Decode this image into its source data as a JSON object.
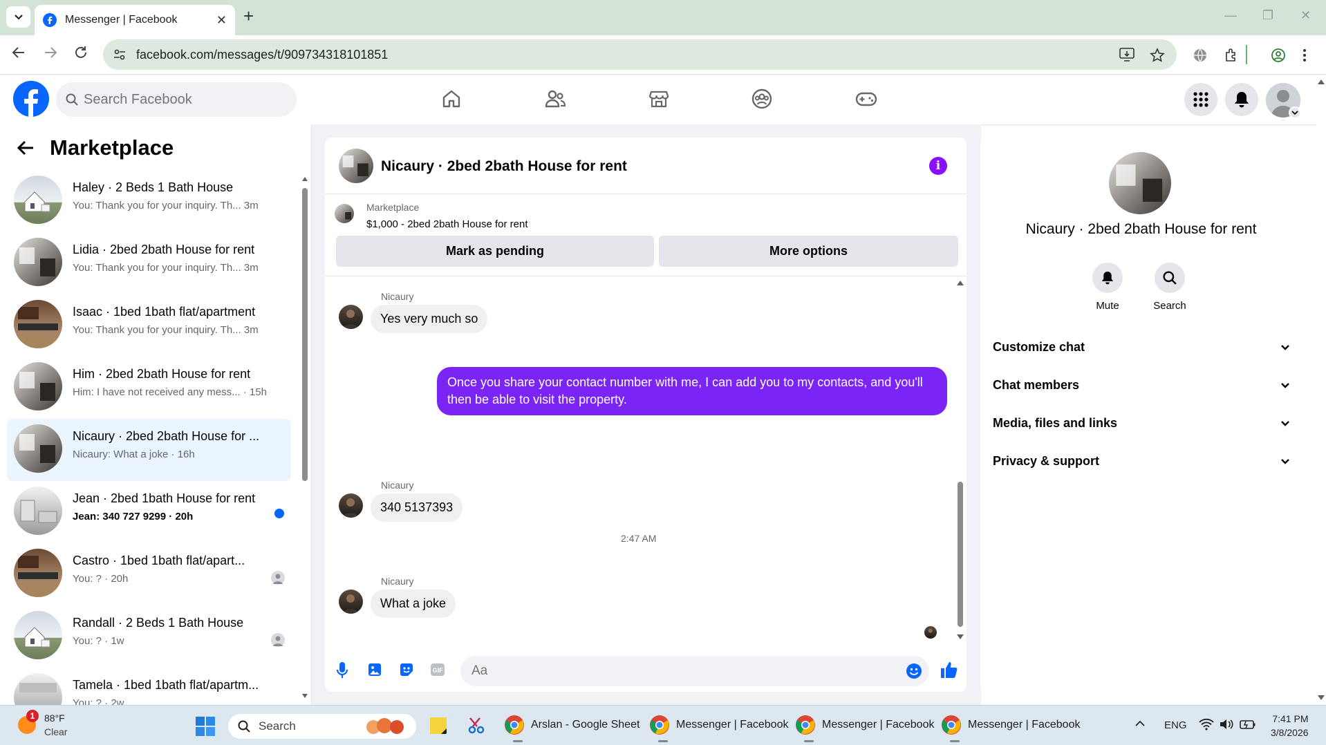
{
  "browser": {
    "tab_title": "Messenger | Facebook",
    "url": "facebook.com/messages/t/909734318101851"
  },
  "facebook": {
    "search_placeholder": "Search Facebook"
  },
  "left_panel": {
    "title": "Marketplace",
    "conversations": [
      {
        "name": "Haley · 2 Beds 1 Bath House",
        "preview": "You: Thank you for your inquiry. Th... 3m",
        "active": false
      },
      {
        "name": "Lidia · 2bed 2bath House for rent",
        "preview": "You: Thank you for your inquiry. Th... 3m",
        "active": false
      },
      {
        "name": "Isaac · 1bed 1bath flat/apartment",
        "preview": "You: Thank you for your inquiry. Th... 3m",
        "active": false
      },
      {
        "name": "Him · 2bed 2bath House for rent",
        "preview": "Him: I have not received any mess... · 15h",
        "active": false
      },
      {
        "name": "Nicaury · 2bed 2bath House for ...",
        "preview": "Nicaury: What a joke · 16h",
        "active": true
      },
      {
        "name": "Jean · 2bed 1bath House for rent",
        "preview": "Jean: 340 727 9299 · 20h",
        "active": false,
        "unread": true
      },
      {
        "name": "Castro · 1bed 1bath flat/apart...",
        "preview": "You: ? · 20h",
        "active": false
      },
      {
        "name": "Randall · 2 Beds 1 Bath House",
        "preview": "You: ? · 1w",
        "active": false
      },
      {
        "name": "Tamela · 1bed 1bath flat/apartm...",
        "preview": "You: ? · 2w",
        "active": false
      }
    ]
  },
  "chat": {
    "title": "Nicaury · 2bed 2bath House for rent",
    "marketplace_label": "Marketplace",
    "listing": "$1,000 - 2bed 2bath House for rent",
    "btn_pending": "Mark as pending",
    "btn_more": "More options",
    "messages": [
      {
        "sender": "Nicaury",
        "text": "Yes very much so"
      },
      {
        "text": "Once you share your contact number with me, I can add you to my contacts, and you'll then be able to visit the property."
      },
      {
        "sender": "Nicaury",
        "text": "340 5137393"
      },
      {
        "timestamp": "2:47 AM"
      },
      {
        "sender": "Nicaury",
        "text": "What a joke"
      }
    ],
    "composer_placeholder": "Aa"
  },
  "right_panel": {
    "title": "Nicaury · 2bed 2bath House for rent",
    "mute": "Mute",
    "search": "Search",
    "sections": [
      "Customize chat",
      "Chat members",
      "Media, files and links",
      "Privacy & support"
    ]
  },
  "taskbar": {
    "weather_temp": "88°F",
    "weather_cond": "Clear",
    "weather_badge": "1",
    "search": "Search",
    "apps": [
      "Arslan - Google Sheet",
      "Messenger | Facebook",
      "Messenger | Facebook",
      "Messenger | Facebook"
    ],
    "lang": "ENG",
    "time": "7:41 PM",
    "date": "3/8/2026"
  },
  "colors": {
    "fb_blue": "#0866ff",
    "outgoing_bubble": "#7a24f5",
    "active_row": "#ebf5ff"
  }
}
